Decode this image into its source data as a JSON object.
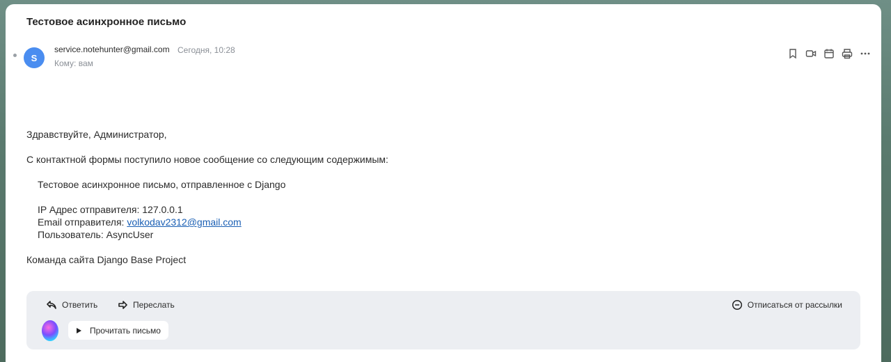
{
  "email": {
    "subject": "Тестовое асинхронное письмо",
    "avatar_letter": "S",
    "sender": "service.notehunter@gmail.com",
    "date": "Сегодня, 10:28",
    "to": "Кому: вам"
  },
  "toolbar_icons": [
    "bookmark-icon",
    "video-icon",
    "calendar-icon",
    "print-icon",
    "more-icon"
  ],
  "body": {
    "greeting": "Здравствуйте, Администратор,",
    "intro": "С контактной формы поступило новое сообщение со следующим содержимым:",
    "message": "Тестовое асинхронное письмо, отправленное с Django",
    "ip_line": "IP Адрес отправителя: 127.0.0.1",
    "email_label": "Email отправителя: ",
    "email_link": "volkodav2312@gmail.com",
    "user_line": "Пользователь: AsyncUser",
    "signature": "Команда сайта Django Base Project"
  },
  "actions": {
    "reply": "Ответить",
    "forward": "Переслать",
    "unsubscribe": "Отписаться от рассылки",
    "read_aloud": "Прочитать письмо"
  }
}
